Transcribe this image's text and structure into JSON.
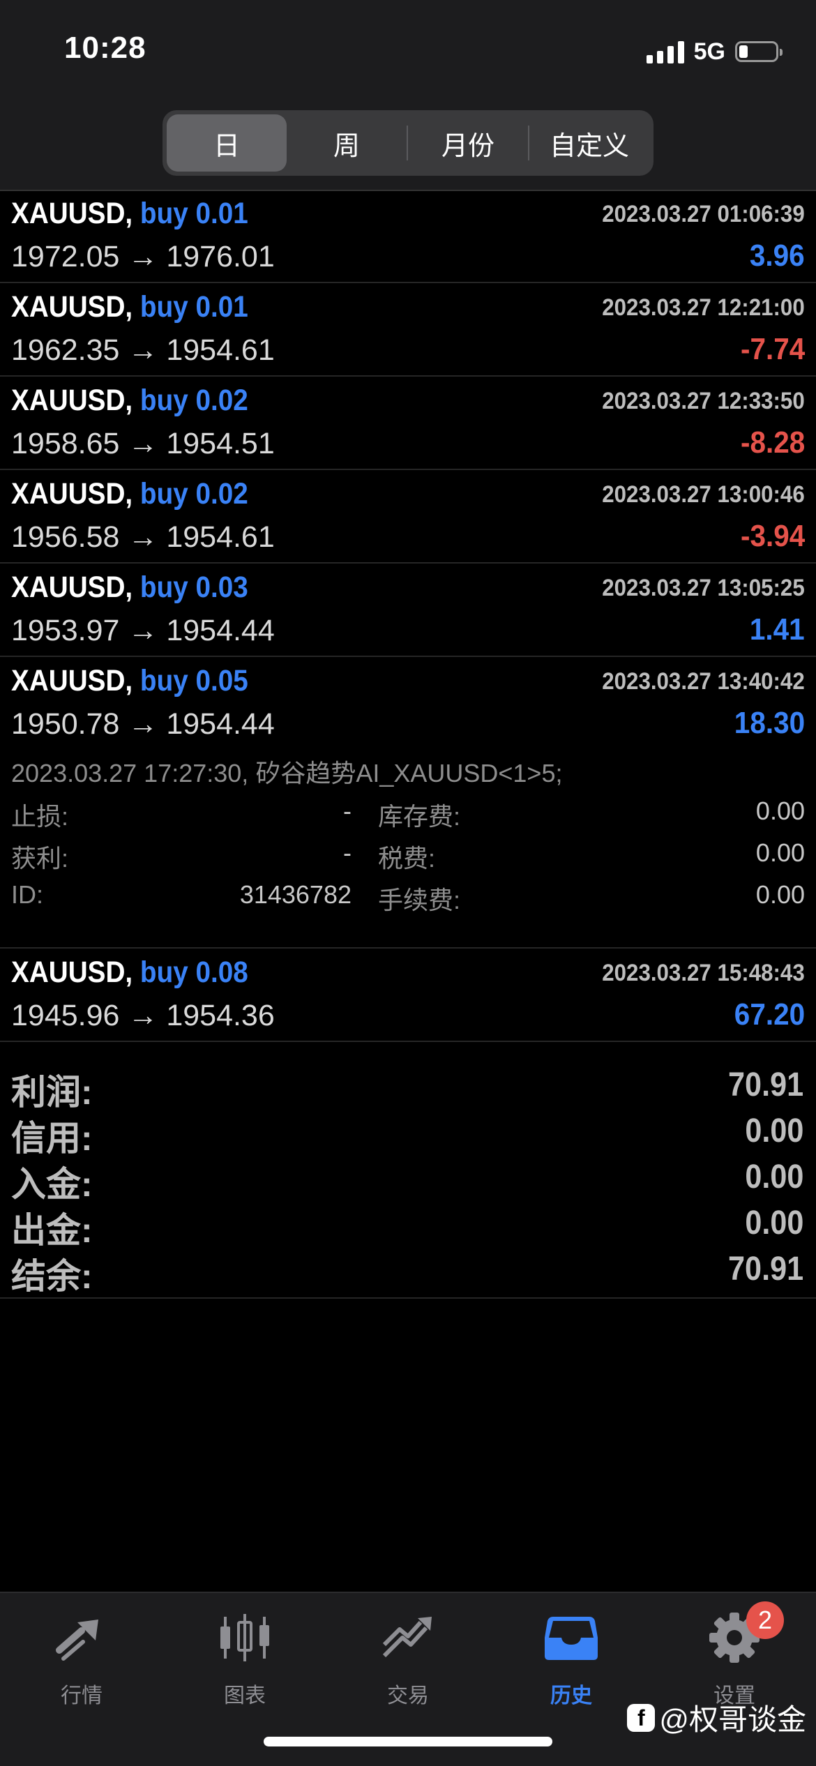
{
  "status_bar": {
    "time": "10:28",
    "network": "5G"
  },
  "period_tabs": [
    {
      "label": "日",
      "active": true
    },
    {
      "label": "周",
      "active": false
    },
    {
      "label": "月份",
      "active": false
    },
    {
      "label": "自定义",
      "active": false
    }
  ],
  "deals": [
    {
      "symbol": "XAUUSD,",
      "side": "buy 0.01",
      "time": "2023.03.27 01:06:39",
      "prices": "1972.05 → 1976.01",
      "profit": "3.96",
      "profit_sign": "pos"
    },
    {
      "symbol": "XAUUSD,",
      "side": "buy 0.01",
      "time": "2023.03.27 12:21:00",
      "prices": "1962.35 → 1954.61",
      "profit": "-7.74",
      "profit_sign": "neg"
    },
    {
      "symbol": "XAUUSD,",
      "side": "buy 0.02",
      "time": "2023.03.27 12:33:50",
      "prices": "1958.65 → 1954.51",
      "profit": "-8.28",
      "profit_sign": "neg"
    },
    {
      "symbol": "XAUUSD,",
      "side": "buy 0.02",
      "time": "2023.03.27 13:00:46",
      "prices": "1956.58 → 1954.61",
      "profit": "-3.94",
      "profit_sign": "neg"
    },
    {
      "symbol": "XAUUSD,",
      "side": "buy 0.03",
      "time": "2023.03.27 13:05:25",
      "prices": "1953.97 → 1954.44",
      "profit": "1.41",
      "profit_sign": "pos"
    },
    {
      "symbol": "XAUUSD,",
      "side": "buy 0.05",
      "time": "2023.03.27 13:40:42",
      "prices": "1950.78 → 1954.44",
      "profit": "18.30",
      "profit_sign": "pos"
    }
  ],
  "expanded_deal": {
    "comment": "2023.03.27 17:27:30, 矽谷趋势AI_XAUUSD<1>5;",
    "rows": [
      {
        "left_label": "止损:",
        "left_value": "-",
        "right_label": "库存费:",
        "right_value": "0.00"
      },
      {
        "left_label": "获利:",
        "left_value": "-",
        "right_label": "税费:",
        "right_value": "0.00"
      },
      {
        "left_label": "ID:",
        "left_value": "31436782",
        "right_label": "手续费:",
        "right_value": "0.00"
      }
    ]
  },
  "last_deal": {
    "symbol": "XAUUSD,",
    "side": "buy 0.08",
    "time": "2023.03.27 15:48:43",
    "prices": "1945.96 → 1954.36",
    "profit": "67.20",
    "profit_sign": "pos"
  },
  "summary": [
    {
      "label": "利润:",
      "value": "70.91"
    },
    {
      "label": "信用:",
      "value": "0.00"
    },
    {
      "label": "入金:",
      "value": "0.00"
    },
    {
      "label": "出金:",
      "value": "0.00"
    },
    {
      "label": "结余:",
      "value": "70.91"
    }
  ],
  "tab_bar": [
    {
      "label": "行情",
      "icon": "quotes-icon",
      "active": false
    },
    {
      "label": "图表",
      "icon": "chart-candles-icon",
      "active": false
    },
    {
      "label": "交易",
      "icon": "trade-icon",
      "active": false
    },
    {
      "label": "历史",
      "icon": "history-inbox-icon",
      "active": true
    },
    {
      "label": "设置",
      "icon": "gear-icon",
      "active": false,
      "badge": "2"
    }
  ],
  "watermark": {
    "logo": "f",
    "text": "@权哥谈金"
  },
  "colors": {
    "background": "#000000",
    "bars": "#1c1c1e",
    "accent_blue": "#3a82f6",
    "loss_red": "#e5534b",
    "muted_text": "#8e8e8e"
  }
}
